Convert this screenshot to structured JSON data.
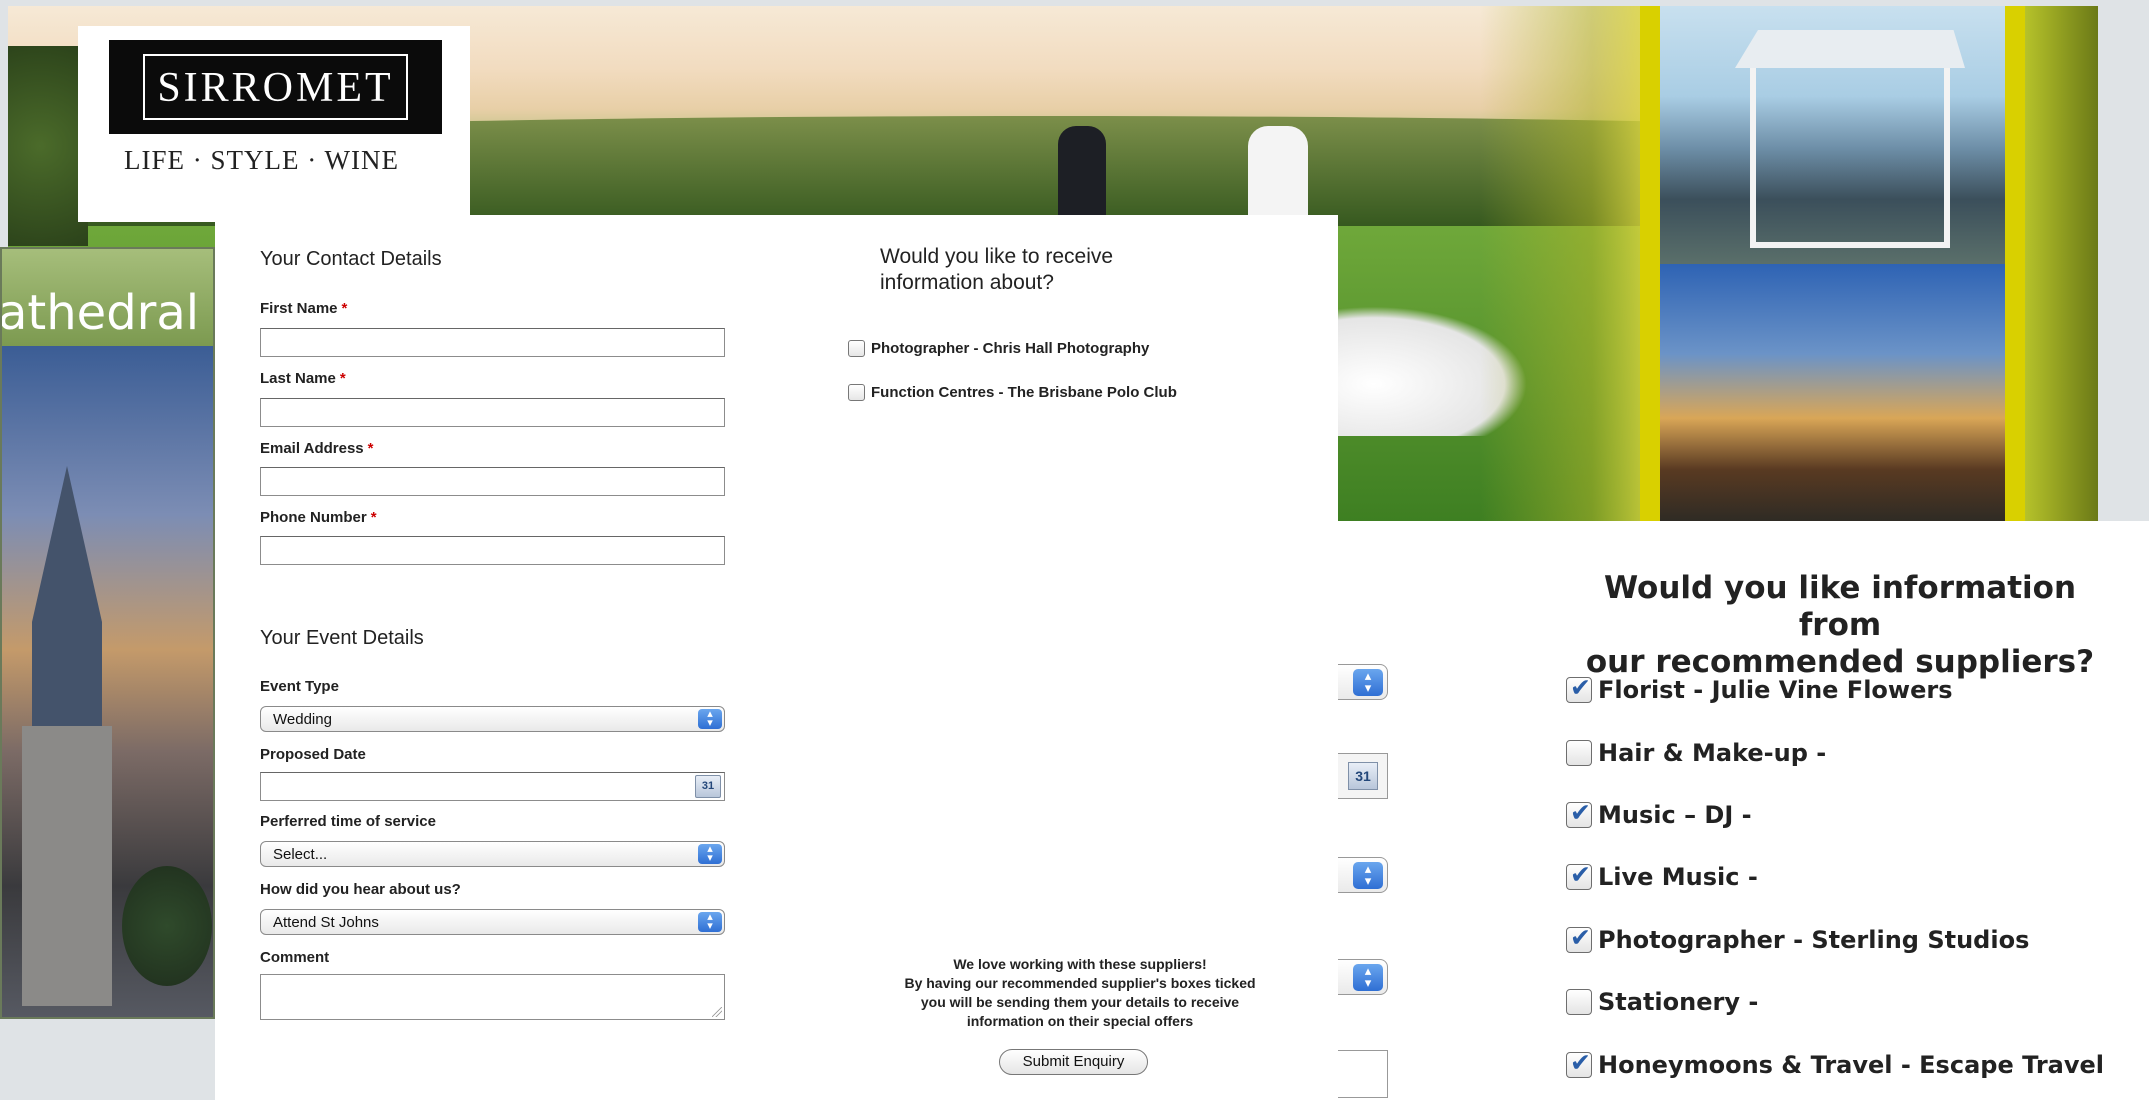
{
  "logo": {
    "name": "SIRROMET",
    "tagline": "LIFE · STYLE · WINE"
  },
  "cathedral": {
    "title": "athedral"
  },
  "contact": {
    "title": "Your Contact Details",
    "first_name_label": "First Name",
    "last_name_label": "Last Name",
    "email_label": "Email Address",
    "phone_label": "Phone Number",
    "required_marker": "*"
  },
  "event": {
    "title": "Your Event Details",
    "event_type_label": "Event Type",
    "event_type_value": "Wedding",
    "proposed_date_label": "Proposed Date",
    "time_label": "Perferred time of service",
    "time_value": "Select...",
    "hear_label": "How did you hear about us?",
    "hear_value": "Attend St Johns",
    "comment_label": "Comment"
  },
  "info": {
    "title_line1": "Would you like to receive",
    "title_line2": "information about?",
    "options": [
      {
        "label": "Photographer - Chris Hall Photography",
        "checked": false
      },
      {
        "label": "Function Centres - The Brisbane Polo Club",
        "checked": false
      }
    ]
  },
  "note": {
    "line1": "We love working with these suppliers!",
    "line2": "By having our recommended supplier's boxes ticked",
    "line3": "you will be sending them your details to receive",
    "line4": "information on their special offers"
  },
  "submit_label": "Submit Enquiry",
  "calendar_icon": "calendar-icon",
  "suppliers": {
    "title_line1": "Would you like information from",
    "title_line2": "our recommended suppliers?",
    "items": [
      {
        "label": "Florist - Julie Vine Flowers",
        "checked": true
      },
      {
        "label": "Hair & Make-up -",
        "checked": false
      },
      {
        "label": "Music – DJ -",
        "checked": true
      },
      {
        "label": "Live Music -",
        "checked": true
      },
      {
        "label": "Photographer - Sterling Studios",
        "checked": true
      },
      {
        "label": "Stationery -",
        "checked": false
      },
      {
        "label": "Honeymoons & Travel - Escape Travel",
        "checked": true
      }
    ]
  }
}
